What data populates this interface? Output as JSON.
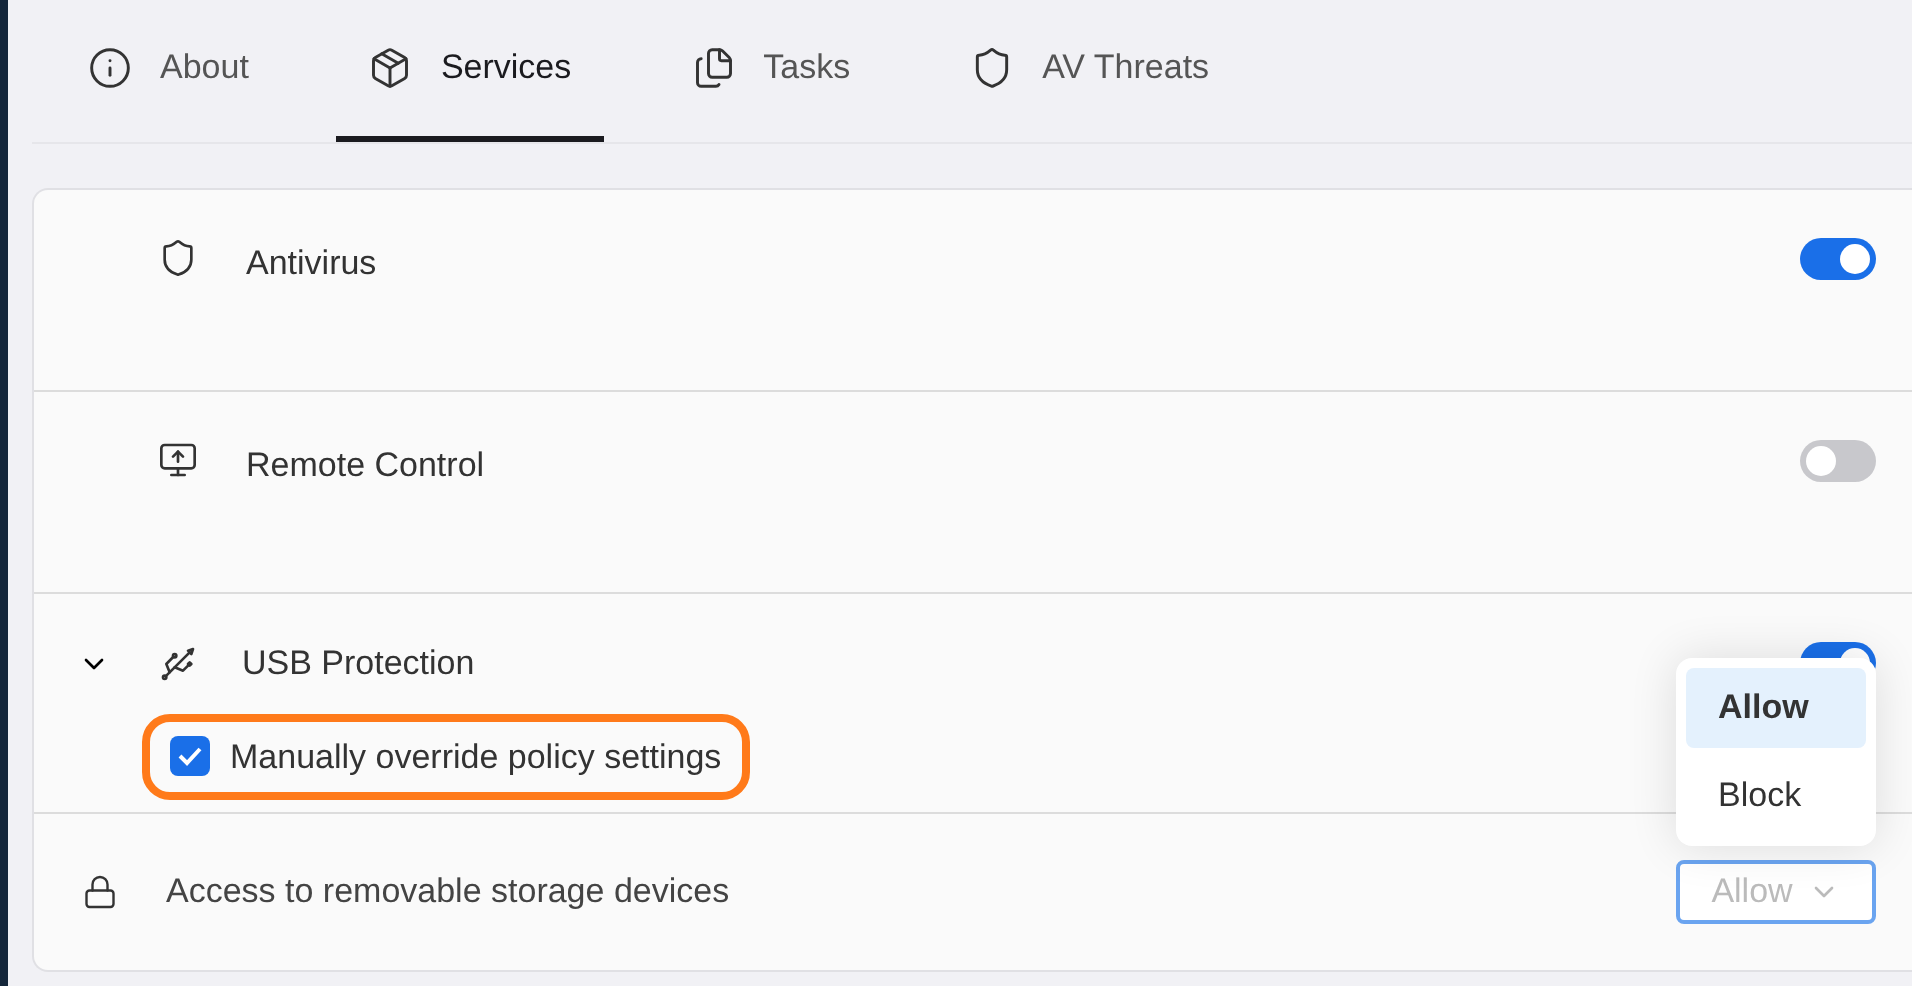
{
  "tabs": [
    {
      "label": "About",
      "selected": false
    },
    {
      "label": "Services",
      "selected": true
    },
    {
      "label": "Tasks",
      "selected": false
    },
    {
      "label": "AV Threats",
      "selected": false
    }
  ],
  "services": [
    {
      "kind": "service",
      "label": "Antivirus",
      "on": true
    },
    {
      "kind": "service",
      "label": "Remote Control",
      "on": false
    },
    {
      "kind": "group",
      "label": "USB Protection",
      "on": true,
      "expanded": true,
      "override": {
        "label": "Manually override policy settings",
        "checked": true,
        "highlighted": true
      }
    },
    {
      "kind": "setting",
      "label": "Access to removable storage devices",
      "select": {
        "value": "Allow",
        "open": true,
        "options": [
          {
            "label": "Allow",
            "selected": true
          },
          {
            "label": "Block",
            "selected": false
          }
        ]
      }
    }
  ]
}
